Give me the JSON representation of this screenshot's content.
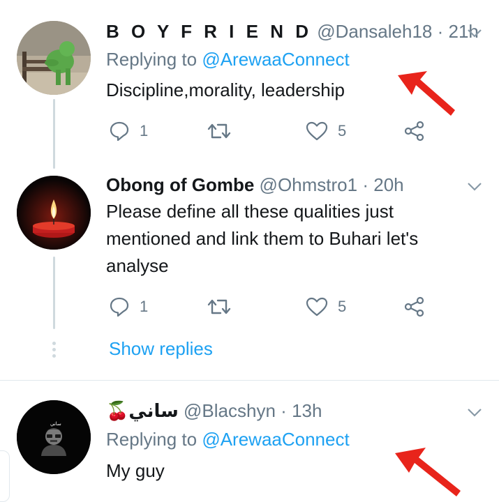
{
  "tweets": [
    {
      "display_name": "B O Y F R I E N D",
      "handle": "@Dansaleh18",
      "separator": "·",
      "time": "21h",
      "replying_label": "Replying to",
      "replying_handle": "@ArewaaConnect",
      "text": "Discipline,morality, leadership",
      "replies": "1",
      "likes": "5"
    },
    {
      "display_name": "Obong of Gombe",
      "handle": "@Ohmstro1",
      "separator": "·",
      "time": "20h",
      "text": "Please define all these qualities just mentioned and link them to Buhari let's analyse",
      "replies": "1",
      "likes": "5"
    },
    {
      "display_name": "ساني",
      "name_emoji": "🍒",
      "handle": "@Blacshyn",
      "separator": "·",
      "time": "13h",
      "replying_label": "Replying to",
      "replying_handle": "@ArewaaConnect",
      "text": "My guy"
    }
  ],
  "show_replies": "Show replies",
  "colors": {
    "accent": "#1da1f2",
    "muted": "#657786",
    "annotation_arrow": "#e8241b"
  },
  "icons": [
    "reply-icon",
    "retweet-icon",
    "like-icon",
    "share-icon",
    "chevron-down-icon"
  ]
}
